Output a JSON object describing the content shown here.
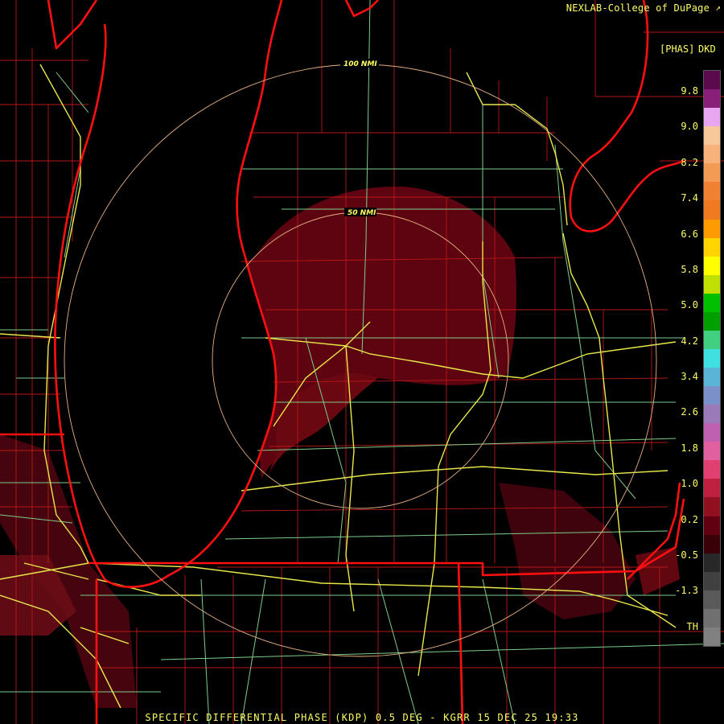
{
  "credit": "NEXLAB-College of DuPage",
  "credit_icon": "external-link-icon",
  "legend": {
    "units": "[PHAS]",
    "product": "DKD",
    "ticks": [
      "9.8",
      "9.0",
      "8.2",
      "7.4",
      "6.6",
      "5.8",
      "5.0",
      "4.2",
      "3.4",
      "2.6",
      "1.8",
      "1.0",
      "0.2",
      "-0.5",
      "-1.3",
      "TH"
    ],
    "colors": [
      "#5c0a4e",
      "#8a1f7a",
      "#e9a6f0",
      "#f6c89a",
      "#f6b27a",
      "#f39a55",
      "#f08032",
      "#f07a20",
      "#ff9a00",
      "#ffd400",
      "#ffff00",
      "#bfe000",
      "#00c000",
      "#00a000",
      "#40d080",
      "#40e0e0",
      "#5ab4d8",
      "#7a90c8",
      "#9a7ab8",
      "#c060b0",
      "#e060a0",
      "#e04070",
      "#c02040",
      "#901020",
      "#600010",
      "#3a0008",
      "#282828",
      "#404040",
      "#5a5a5a",
      "#707070",
      "#808080"
    ]
  },
  "rings": {
    "inner": "50 NMI",
    "outer": "100 NMI"
  },
  "footer": "SPECIFIC DIFFERENTIAL PHASE (KDP) 0.5 DEG - KGRR 15 DEC 25 19:33",
  "colors": {
    "state_border": "#ff1010",
    "county": "#c01818",
    "highway": "#e8e84a",
    "road": "#7ecc8a",
    "echo": "#5e0410",
    "echo_light": "#7a0814",
    "ring": "#e6b080"
  }
}
